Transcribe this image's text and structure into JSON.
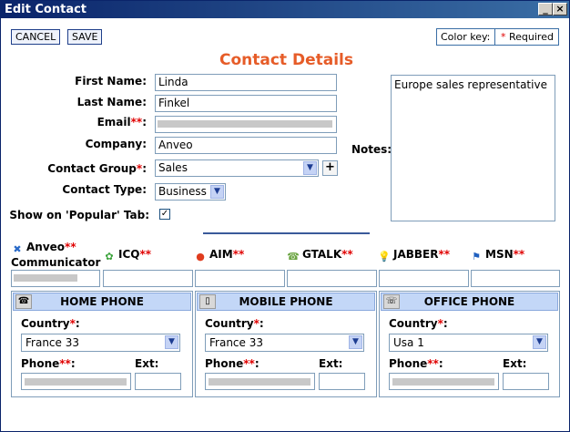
{
  "window": {
    "title": "Edit Contact",
    "minimize_glyph": "_",
    "close_glyph": "×"
  },
  "toolbar": {
    "cancel_label": "CANCEL",
    "save_label": "SAVE"
  },
  "color_key": {
    "label": "Color key:",
    "marker": "*",
    "required_label": " Required"
  },
  "heading": "Contact Details",
  "fields": {
    "first_name": {
      "label": "First Name:",
      "value": "Linda"
    },
    "last_name": {
      "label": "Last Name:",
      "value": "Finkel"
    },
    "email": {
      "label": "Email",
      "marker": "**",
      "colon": ":",
      "value": ""
    },
    "company": {
      "label": "Company:",
      "value": "Anveo"
    },
    "contact_group": {
      "label": "Contact Group",
      "marker": "*",
      "colon": ":",
      "value": "Sales",
      "add_glyph": "+"
    },
    "contact_type": {
      "label": "Contact Type:",
      "value": "Business"
    },
    "show_popular": {
      "label": "Show on 'Popular' Tab:",
      "checked": true,
      "check_glyph": "✓"
    }
  },
  "notes": {
    "label": "Notes:",
    "value": "Europe sales representative"
  },
  "im": [
    {
      "name": "Anveo",
      "name2": "Communicator",
      "marker": "**",
      "icon": "anveo-icon",
      "glyph": "✖",
      "color": "#2a6ac8"
    },
    {
      "name": "ICQ",
      "marker": "**",
      "icon": "icq-flower-icon",
      "glyph": "✿",
      "color": "#3aa23a"
    },
    {
      "name": "AIM",
      "marker": "**",
      "icon": "aim-icon",
      "glyph": "●",
      "color": "#e03c1e"
    },
    {
      "name": "GTALK",
      "marker": "**",
      "icon": "gtalk-icon",
      "glyph": "☎",
      "color": "#6ba442"
    },
    {
      "name": "JABBER",
      "marker": "**",
      "icon": "jabber-bulb-icon",
      "glyph": "💡",
      "color": "#e07a1e"
    },
    {
      "name": "MSN",
      "marker": "**",
      "icon": "msn-icon",
      "glyph": "⚑",
      "color": "#1f5fbf"
    }
  ],
  "phones": [
    {
      "title": "HOME PHONE",
      "icon": "home-phone-icon",
      "glyph": "☎",
      "country_label": "Country",
      "marker": "*",
      "country": "France 33",
      "phone_label": "Phone",
      "phone_marker": "**",
      "ext_label": "Ext:"
    },
    {
      "title": "MOBILE PHONE",
      "icon": "mobile-phone-icon",
      "glyph": "▯",
      "country_label": "Country",
      "marker": "*",
      "country": "France 33",
      "phone_label": "Phone",
      "phone_marker": "**",
      "ext_label": "Ext:"
    },
    {
      "title": "OFFICE PHONE",
      "icon": "office-phone-icon",
      "glyph": "☏",
      "country_label": "Country",
      "marker": "*",
      "country": "Usa 1",
      "phone_label": "Phone",
      "phone_marker": "**",
      "ext_label": "Ext:"
    }
  ],
  "colors": {
    "accent": "#e65c28",
    "required": "#e00000",
    "header_bg": "#c3d7f7",
    "title_bar": "#0a246a"
  }
}
